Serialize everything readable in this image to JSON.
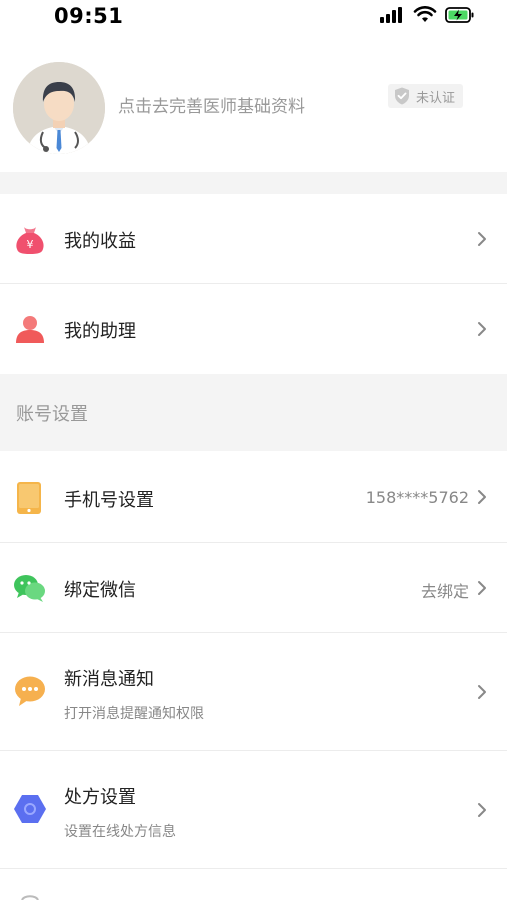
{
  "status_bar": {
    "time": "09:51"
  },
  "profile": {
    "prompt": "点击去完善医师基础资料",
    "cert_badge": "未认证"
  },
  "menu": [
    {
      "label": "我的收益",
      "icon": "money-bag-icon"
    },
    {
      "label": "我的助理",
      "icon": "assistant-person-icon"
    }
  ],
  "account_settings": {
    "header": "账号设置",
    "items": [
      {
        "label": "手机号设置",
        "value": "158****5762",
        "icon": "phone-icon"
      },
      {
        "label": "绑定微信",
        "value": "去绑定",
        "icon": "wechat-icon"
      },
      {
        "label": "新消息通知",
        "sub": "打开消息提醒通知权限",
        "icon": "notification-chat-icon"
      },
      {
        "label": "处方设置",
        "sub": "设置在线处方信息",
        "icon": "prescription-hexagon-icon"
      }
    ]
  },
  "colors": {
    "earnings_icon": "#f0506e",
    "assistant_icon": "#f05a5a",
    "phone_icon": "#f5b54a",
    "wechat_icon": "#4fcf6a",
    "notify_icon": "#f6b04f",
    "prescription_icon": "#5b6ff0"
  }
}
